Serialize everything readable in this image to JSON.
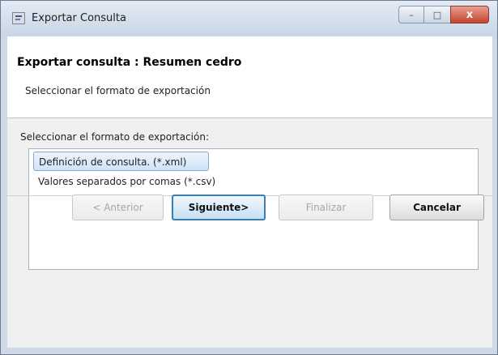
{
  "window": {
    "title": "Exportar Consulta",
    "controls": {
      "minimize": "–",
      "maximize": "□",
      "close": "x"
    }
  },
  "header": {
    "title": "Exportar consulta : Resumen cedro",
    "subtitle": "Seleccionar el formato de exportación"
  },
  "format_section": {
    "label": "Seleccionar el formato de exportación:",
    "options": [
      {
        "label": "Definición de consulta. (*.xml)",
        "selected": true
      },
      {
        "label": "Valores separados por comas (*.csv)",
        "selected": false
      }
    ]
  },
  "buttons": {
    "back": "< Anterior",
    "next": "Siguiente>",
    "finish": "Finalizar",
    "cancel": "Cancelar"
  },
  "colors": {
    "title_bar": "#c9d6e6",
    "selection": "#cfe2f7",
    "close_button": "#c4432b",
    "primary_button_border": "#3c7fb1"
  }
}
